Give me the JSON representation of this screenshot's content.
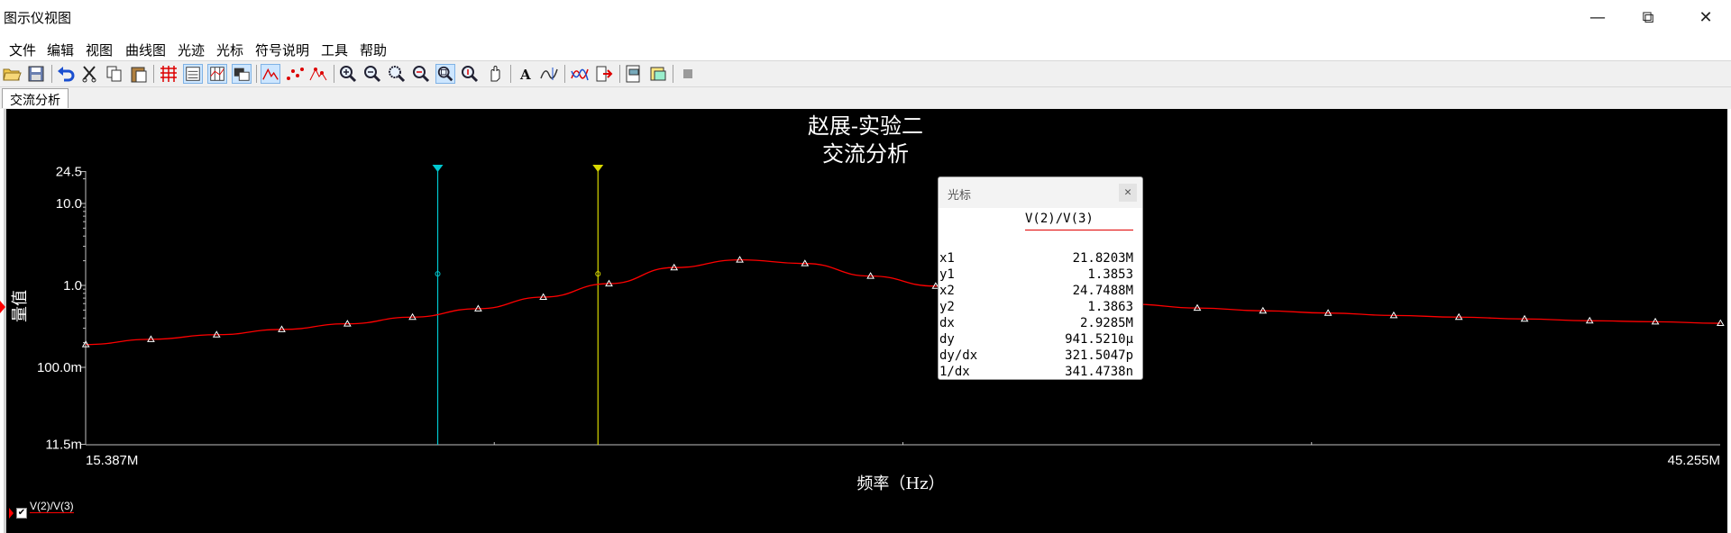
{
  "window": {
    "title": "图示仪视图",
    "controls": {
      "minimize": "—",
      "maximize": "⧉",
      "close": "✕"
    }
  },
  "menu": [
    "文件",
    "编辑",
    "视图",
    "曲线图",
    "光迹",
    "光标",
    "符号说明",
    "工具",
    "帮助"
  ],
  "tabs": [
    "交流分析"
  ],
  "toolbar": {
    "text_tool_glyph": "A"
  },
  "plot": {
    "title_line1": "赵展-实验二",
    "title_line2": "交流分析",
    "ylabel": "量值",
    "xlabel": "频率（Hz）",
    "x_start_label": "15.387M",
    "x_end_label": "45.255M",
    "ytick_labels": [
      "24.5",
      "10.0",
      "1.0",
      "100.0m",
      "11.5m"
    ],
    "colors": {
      "background": "#000000",
      "trace": "#ff0000",
      "cursor1": "#00c8d0",
      "cursor2": "#d8d800",
      "axis": "#c0c0c0"
    }
  },
  "chart_data": {
    "type": "line",
    "xscale": "linear",
    "yscale": "log",
    "xlim": [
      15.387,
      45.255
    ],
    "ylim": [
      0.0115,
      24.5
    ],
    "x_unit": "MHz",
    "yticks": [
      24.5,
      10.0,
      1.0,
      0.1,
      0.0115
    ],
    "series": [
      {
        "name": "V(2)/V(3)",
        "x": [
          15.39,
          16.58,
          17.78,
          18.97,
          20.17,
          21.36,
          22.56,
          23.75,
          24.95,
          26.14,
          27.34,
          28.53,
          29.73,
          30.92,
          32.12,
          33.31,
          34.51,
          35.7,
          36.9,
          38.09,
          39.29,
          40.48,
          41.68,
          42.87,
          44.07,
          45.26
        ],
        "y": [
          0.19,
          0.22,
          0.25,
          0.29,
          0.34,
          0.41,
          0.52,
          0.72,
          1.05,
          1.65,
          2.05,
          1.85,
          1.3,
          0.98,
          0.79,
          0.67,
          0.59,
          0.53,
          0.49,
          0.46,
          0.43,
          0.41,
          0.39,
          0.37,
          0.36,
          0.345
        ]
      }
    ],
    "cursors": [
      {
        "name": "1",
        "x": 21.8203,
        "y": 1.3853,
        "color": "#00c8d0"
      },
      {
        "name": "2",
        "x": 24.7488,
        "y": 1.3863,
        "color": "#d8d800"
      }
    ],
    "grid": false,
    "legend": "bottom-left"
  },
  "cursor_panel": {
    "title": "光标",
    "close_glyph": "✕",
    "column": "V(2)/V(3)",
    "rows": [
      {
        "label": "x1",
        "value": "21.8203M"
      },
      {
        "label": "y1",
        "value": "1.3853"
      },
      {
        "label": "x2",
        "value": "24.7488M"
      },
      {
        "label": "y2",
        "value": "1.3863"
      },
      {
        "label": "dx",
        "value": "2.9285M"
      },
      {
        "label": "dy",
        "value": "941.5210μ"
      },
      {
        "label": "dy/dx",
        "value": "321.5047p"
      },
      {
        "label": "1/dx",
        "value": "341.4738n"
      }
    ]
  },
  "legend": {
    "label": "V(2)/V(3)",
    "checked_glyph": "✔"
  }
}
